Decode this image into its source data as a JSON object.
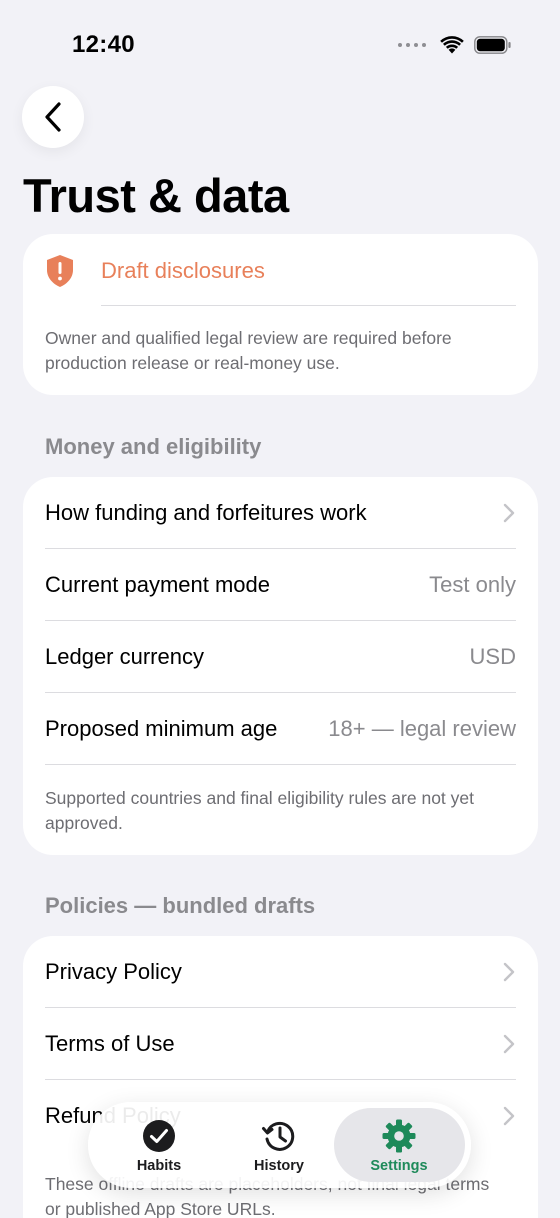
{
  "status_bar": {
    "time": "12:40"
  },
  "header": {
    "title": "Trust & data"
  },
  "disclosure": {
    "title": "Draft disclosures",
    "note": "Owner and qualified legal review are required before production release or real-money use.",
    "accent_color": "#E8805A",
    "icon": "shield-exclamation-icon"
  },
  "money_section": {
    "header": "Money and eligibility",
    "rows": [
      {
        "label": "How funding and forfeitures work",
        "value": ""
      },
      {
        "label": "Current payment mode",
        "value": "Test only"
      },
      {
        "label": "Ledger currency",
        "value": "USD"
      },
      {
        "label": "Proposed minimum age",
        "value": "18+ — legal review"
      }
    ],
    "footnote": "Supported countries and final eligibility rules are not yet approved."
  },
  "policies_section": {
    "header": "Policies — bundled drafts",
    "rows": [
      {
        "label": "Privacy Policy"
      },
      {
        "label": "Terms of Use"
      },
      {
        "label": "Refund Policy"
      }
    ],
    "footnote": "These offline drafts are placeholders, not final legal terms or published App Store URLs."
  },
  "tab_bar": {
    "active": "Settings",
    "active_color": "#1E8A5A",
    "tabs": [
      {
        "label": "Habits",
        "icon": "checkmark-circle-icon"
      },
      {
        "label": "History",
        "icon": "history-clock-icon"
      },
      {
        "label": "Settings",
        "icon": "gear-icon"
      }
    ]
  }
}
